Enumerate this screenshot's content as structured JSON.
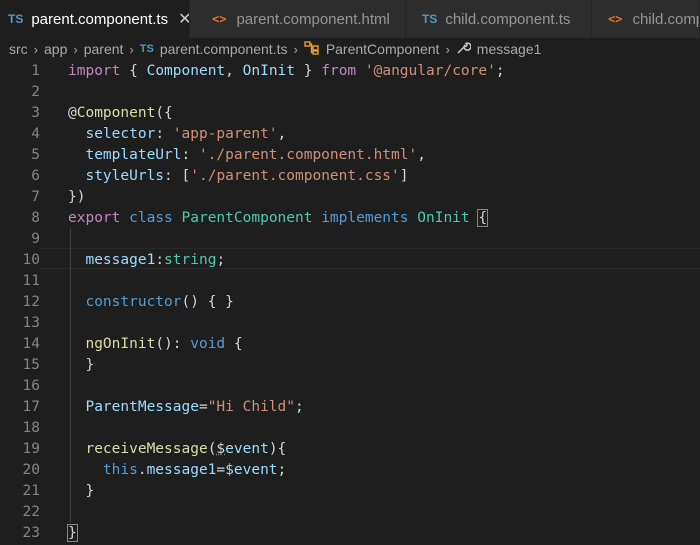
{
  "tabs": [
    {
      "icon": "TS",
      "label": "parent.component.ts",
      "active": true,
      "close": "✕"
    },
    {
      "icon": "<>",
      "label": "parent.component.html",
      "active": false
    },
    {
      "icon": "TS",
      "label": "child.component.ts",
      "active": false
    },
    {
      "icon": "<>",
      "label": "child.compo",
      "active": false
    }
  ],
  "breadcrumb": {
    "items": [
      "src",
      "app",
      "parent",
      "parent.component.ts",
      "ParentComponent",
      "message1"
    ],
    "ts_icon": "TS"
  },
  "editor": {
    "line_numbers": [
      "1",
      "2",
      "3",
      "4",
      "5",
      "6",
      "7",
      "8",
      "9",
      "10",
      "11",
      "12",
      "13",
      "14",
      "15",
      "16",
      "17",
      "18",
      "19",
      "20",
      "21",
      "22",
      "23"
    ],
    "lines": [
      [
        [
          "kw",
          "import"
        ],
        [
          "pun",
          " { "
        ],
        [
          "var",
          "Component"
        ],
        [
          "pun",
          ", "
        ],
        [
          "var",
          "OnInit"
        ],
        [
          "pun",
          " } "
        ],
        [
          "kw",
          "from"
        ],
        [
          "pun",
          " "
        ],
        [
          "str",
          "'@angular/core'"
        ],
        [
          "pun",
          ";"
        ]
      ],
      [],
      [
        [
          "pun",
          "@"
        ],
        [
          "fn",
          "Component"
        ],
        [
          "pun",
          "({"
        ]
      ],
      [
        [
          "pun",
          "  "
        ],
        [
          "var",
          "selector"
        ],
        [
          "pun",
          ": "
        ],
        [
          "str",
          "'app-parent'"
        ],
        [
          "pun",
          ","
        ]
      ],
      [
        [
          "pun",
          "  "
        ],
        [
          "var",
          "templateUrl"
        ],
        [
          "pun",
          ": "
        ],
        [
          "str",
          "'./parent.component.html'"
        ],
        [
          "pun",
          ","
        ]
      ],
      [
        [
          "pun",
          "  "
        ],
        [
          "var",
          "styleUrls"
        ],
        [
          "pun",
          ": ["
        ],
        [
          "str",
          "'./parent.component.css'"
        ],
        [
          "pun",
          "]"
        ]
      ],
      [
        [
          "pun",
          "})"
        ]
      ],
      [
        [
          "kw",
          "export"
        ],
        [
          "pun",
          " "
        ],
        [
          "blue",
          "class"
        ],
        [
          "pun",
          " "
        ],
        [
          "cls",
          "ParentComponent"
        ],
        [
          "pun",
          " "
        ],
        [
          "blue",
          "implements"
        ],
        [
          "pun",
          " "
        ],
        [
          "cls",
          "OnInit"
        ],
        [
          "pun",
          " "
        ],
        [
          "brk",
          "{"
        ]
      ],
      [],
      [
        [
          "pun",
          "  "
        ],
        [
          "var",
          "message1"
        ],
        [
          "pun",
          ":"
        ],
        [
          "cls",
          "string"
        ],
        [
          "pun",
          ";"
        ]
      ],
      [],
      [
        [
          "pun",
          "  "
        ],
        [
          "blue",
          "constructor"
        ],
        [
          "pun",
          "() { }"
        ]
      ],
      [],
      [
        [
          "pun",
          "  "
        ],
        [
          "fn",
          "ngOnInit"
        ],
        [
          "pun",
          "(): "
        ],
        [
          "blue",
          "void"
        ],
        [
          "pun",
          " {"
        ]
      ],
      [
        [
          "pun",
          "  }"
        ]
      ],
      [],
      [
        [
          "pun",
          "  "
        ],
        [
          "var",
          "ParentMessage"
        ],
        [
          "pun",
          "="
        ],
        [
          "str",
          "\"Hi Child\""
        ],
        [
          "pun",
          ";"
        ]
      ],
      [],
      [
        [
          "pun",
          "  "
        ],
        [
          "fn",
          "receiveMessage"
        ],
        [
          "pun",
          "("
        ],
        [
          "dots",
          "$"
        ],
        [
          "var",
          "event"
        ],
        [
          "pun",
          "){"
        ]
      ],
      [
        [
          "pun",
          "    "
        ],
        [
          "blue",
          "this"
        ],
        [
          "pun",
          "."
        ],
        [
          "var",
          "message1"
        ],
        [
          "pun",
          "="
        ],
        [
          "var",
          "$event"
        ],
        [
          "pun",
          ";"
        ]
      ],
      [
        [
          "pun",
          "  }"
        ]
      ],
      [],
      [
        [
          "brk",
          "}"
        ]
      ]
    ]
  },
  "colors": {
    "background": "#1e1e1e",
    "tab_bar": "#252526",
    "keyword": "#c586c0",
    "string": "#ce9178",
    "type": "#4ec9b0",
    "variable": "#9cdcfe",
    "function": "#dcdcaa"
  }
}
